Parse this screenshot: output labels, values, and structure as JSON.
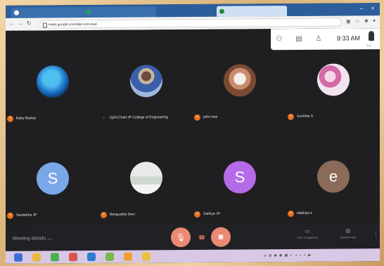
{
  "browser": {
    "tabs": [
      {
        "label": ""
      },
      {
        "label": ""
      },
      {
        "label": ""
      }
    ],
    "url": "meet.google.com/abe-cmt-ewd"
  },
  "meet": {
    "time": "9:33 AM",
    "participants": [
      {
        "name": "Baby Baskar",
        "avatar": "photo",
        "initial": ""
      },
      {
        "name": "IQACChief JP College of Engineering",
        "avatar": "photo",
        "initial": ""
      },
      {
        "name": "jothi rose",
        "avatar": "photo",
        "initial": ""
      },
      {
        "name": "Sumitha S",
        "avatar": "photo",
        "initial": ""
      },
      {
        "name": "Sasirekha JP",
        "avatar": "letter",
        "initial": "S"
      },
      {
        "name": "Banguatha Devi",
        "avatar": "photo",
        "initial": ""
      },
      {
        "name": "Sathiya JP",
        "avatar": "letter",
        "initial": "S"
      },
      {
        "name": "elakkiya k",
        "avatar": "letter",
        "initial": "e"
      }
    ],
    "meeting_details": "Meeting details",
    "captions_label": "Turn on captions",
    "present_label": "Present now"
  },
  "colors": {
    "avatar_s_blue": "#7aa7e8",
    "avatar_s_purple": "#b56be8",
    "avatar_e_brown": "#8a6b58"
  }
}
